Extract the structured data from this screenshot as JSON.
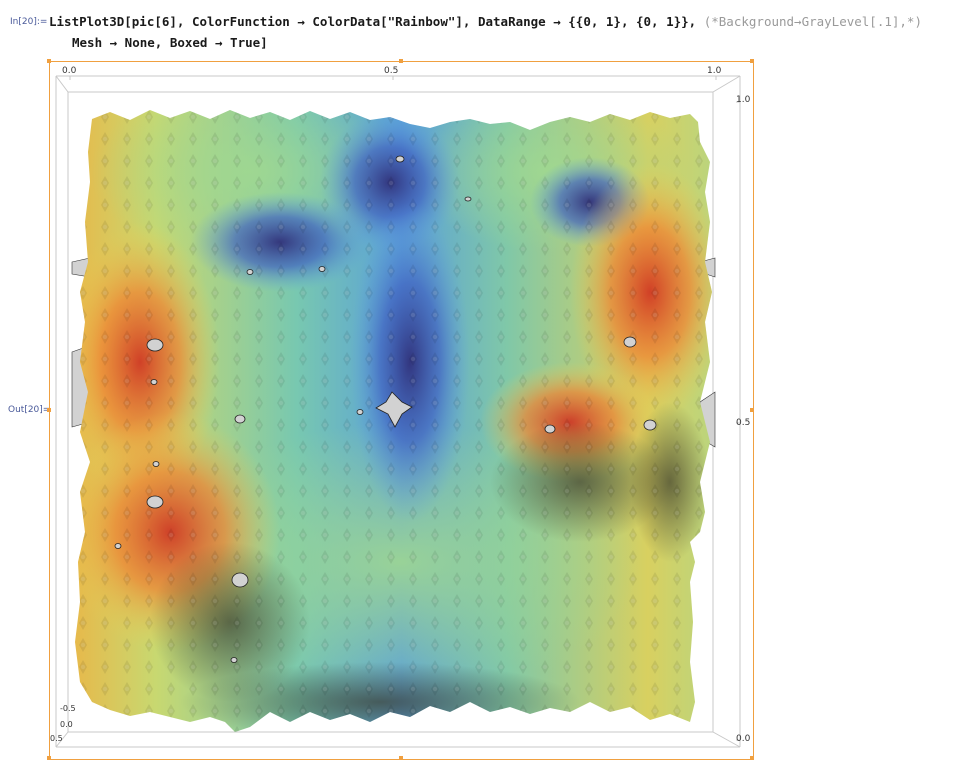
{
  "input": {
    "label": "In[20]:=",
    "line1_code": "ListPlot3D[pic[6], ColorFunction → ColorData[\"Rainbow\"], DataRange → {{0, 1}, {0, 1}}, ",
    "line1_comment": "(*Background→GrayLevel[.1],*)",
    "line2_code": "Mesh → None, Boxed → True]"
  },
  "output": {
    "label": "Out[20]="
  },
  "plot": {
    "colors": {
      "frame_selection": "#f0a040",
      "box_line": "#c8c8c8",
      "background": "#ffffff",
      "hole_fill": "#d8d8d8"
    },
    "top_ticks": [
      "0.0",
      "0.5",
      "1.0"
    ],
    "right_ticks": [
      "1.0",
      "0.5",
      "0.0"
    ],
    "corner_ticks": [
      "-0.5",
      "0.0",
      "0.5"
    ]
  }
}
